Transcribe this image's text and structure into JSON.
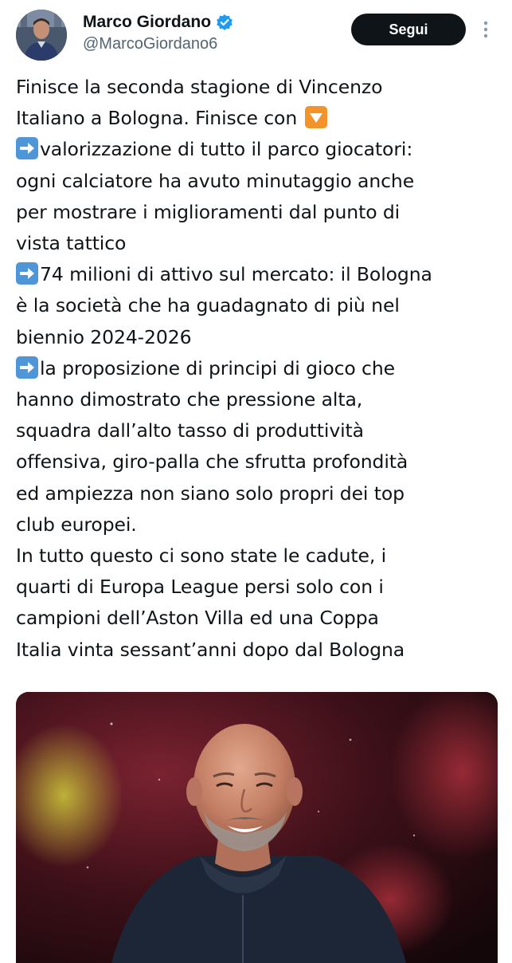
{
  "author": {
    "display_name": "Marco Giordano",
    "handle": "@MarcoGiordano6",
    "avatar_icon": "profile-photo",
    "verified_icon": "verified-badge-icon",
    "verified_color": "#1d9bf0"
  },
  "actions": {
    "follow_label": "Segui",
    "more_icon": "more-vertical-icon"
  },
  "tweet": {
    "lines": [
      "Finisce la seconda stagione di Vincenzo",
      "Italiano a Bologna. Finisce con",
      "valorizzazione di tutto il parco giocatori:",
      "ogni calciatore ha avuto minutaggio anche",
      "per mostrare i miglioramenti dal punto di",
      "vista tattico",
      "74 milioni di attivo sul mercato: il Bologna",
      "è la società che ha guadagnato di più nel",
      "biennio 2024-2026",
      "la proposizione di principi di gioco che",
      "hanno dimostrato che pressione alta,",
      "squadra dall’alto tasso di produttività",
      "offensiva, giro-palla che sfrutta profondità",
      "ed ampiezza non siano solo propri dei top",
      "club europei.",
      "In tutto questo ci sono state le cadute, i",
      "quarti di Europa League persi solo con i",
      "campioni dell’Aston Villa ed una Coppa",
      "Italia vinta sessant’anni dopo dal Bologna"
    ],
    "emoji_down": "down-arrow-button-emoji",
    "emoji_right": "right-arrow-emoji"
  },
  "media": {
    "description_icon": "photo-of-smiling-coach"
  }
}
